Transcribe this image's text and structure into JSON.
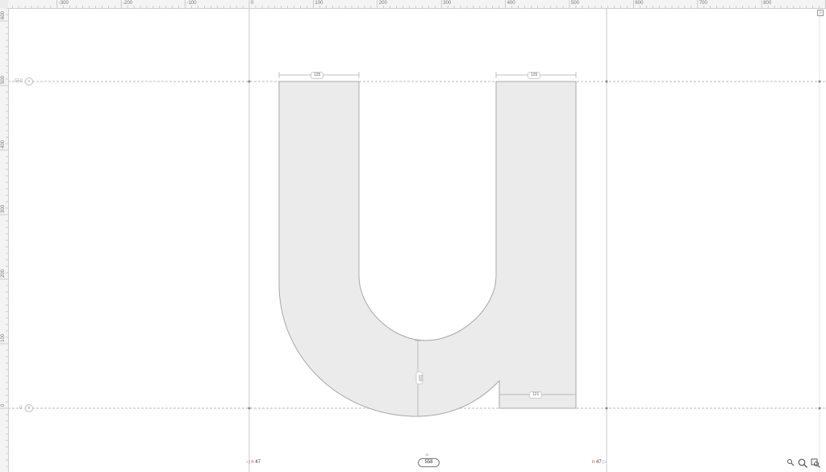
{
  "rulers": {
    "top_labels": [
      "-300",
      "-200",
      "-100",
      "0",
      "100",
      "200",
      "300",
      "400",
      "500",
      "600",
      "700",
      "800"
    ],
    "left_labels": [
      "600",
      "500",
      "400",
      "300",
      "200",
      "100",
      "0"
    ]
  },
  "metrics": {
    "x_height_value": "550",
    "x_height_badge": "x",
    "baseline_value": "0",
    "baseline_badge": "b"
  },
  "glyph": {
    "name": "u",
    "fill": "#ebebeb",
    "stroke": "#a8a8a8"
  },
  "dimensions": {
    "left_stem": "125",
    "right_stem": "125",
    "bowl_thickness": "110",
    "spur_width": "121"
  },
  "sidebearings": {
    "left_symbol": "n",
    "left_value": "47",
    "right_symbol": "n",
    "right_value": "47"
  },
  "advance": {
    "key": "u",
    "width": "558"
  },
  "zoom_controls": [
    "zoom-out-icon",
    "zoom-in-icon",
    "zoom-fit-icon"
  ]
}
